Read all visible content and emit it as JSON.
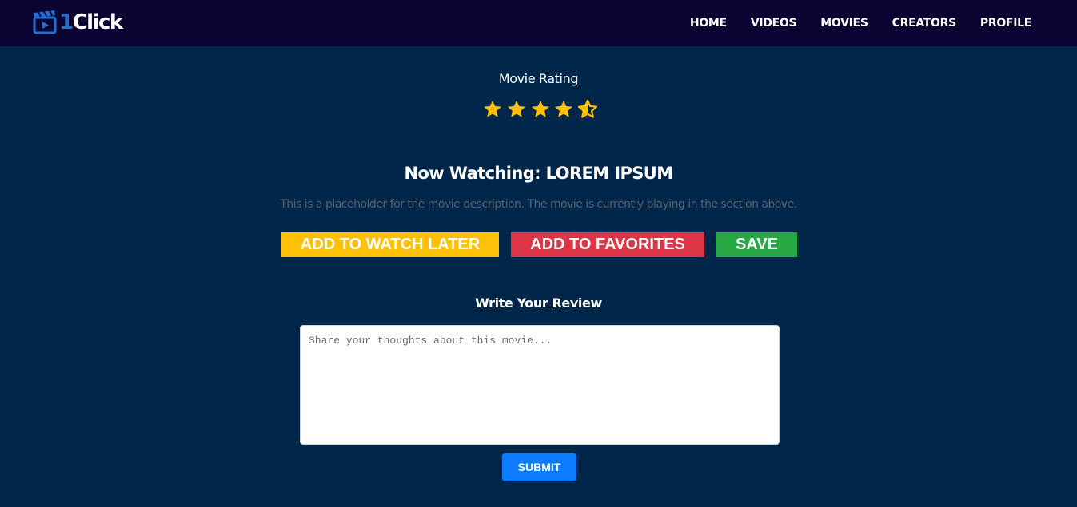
{
  "brand": {
    "number": "1",
    "name": "Click",
    "icon": "clapperboard-icon"
  },
  "nav": [
    {
      "label": "HOME"
    },
    {
      "label": "VIDEOS"
    },
    {
      "label": "MOVIES"
    },
    {
      "label": "CREATORS"
    },
    {
      "label": "PROFILE"
    }
  ],
  "rating": {
    "label": "Movie Rating",
    "value": 4.5,
    "max": 5
  },
  "movie": {
    "heading": "Now Watching: LOREM IPSUM",
    "description": "This is a placeholder for the movie description. The movie is currently playing in the section above."
  },
  "actions": {
    "watch_later": "ADD TO WATCH LATER",
    "favorites": "ADD TO FAVORITES",
    "save": "SAVE"
  },
  "review": {
    "title": "Write Your Review",
    "placeholder": "Share your thoughts about this movie...",
    "submit": "SUBMIT"
  },
  "colors": {
    "page_bg": "#00264a",
    "navbar_bg": "#0b0432",
    "star": "#ffc107",
    "watch_later": "#ffc107",
    "favorites": "#dc3545",
    "save": "#28a745",
    "submit": "#0d7bff"
  }
}
